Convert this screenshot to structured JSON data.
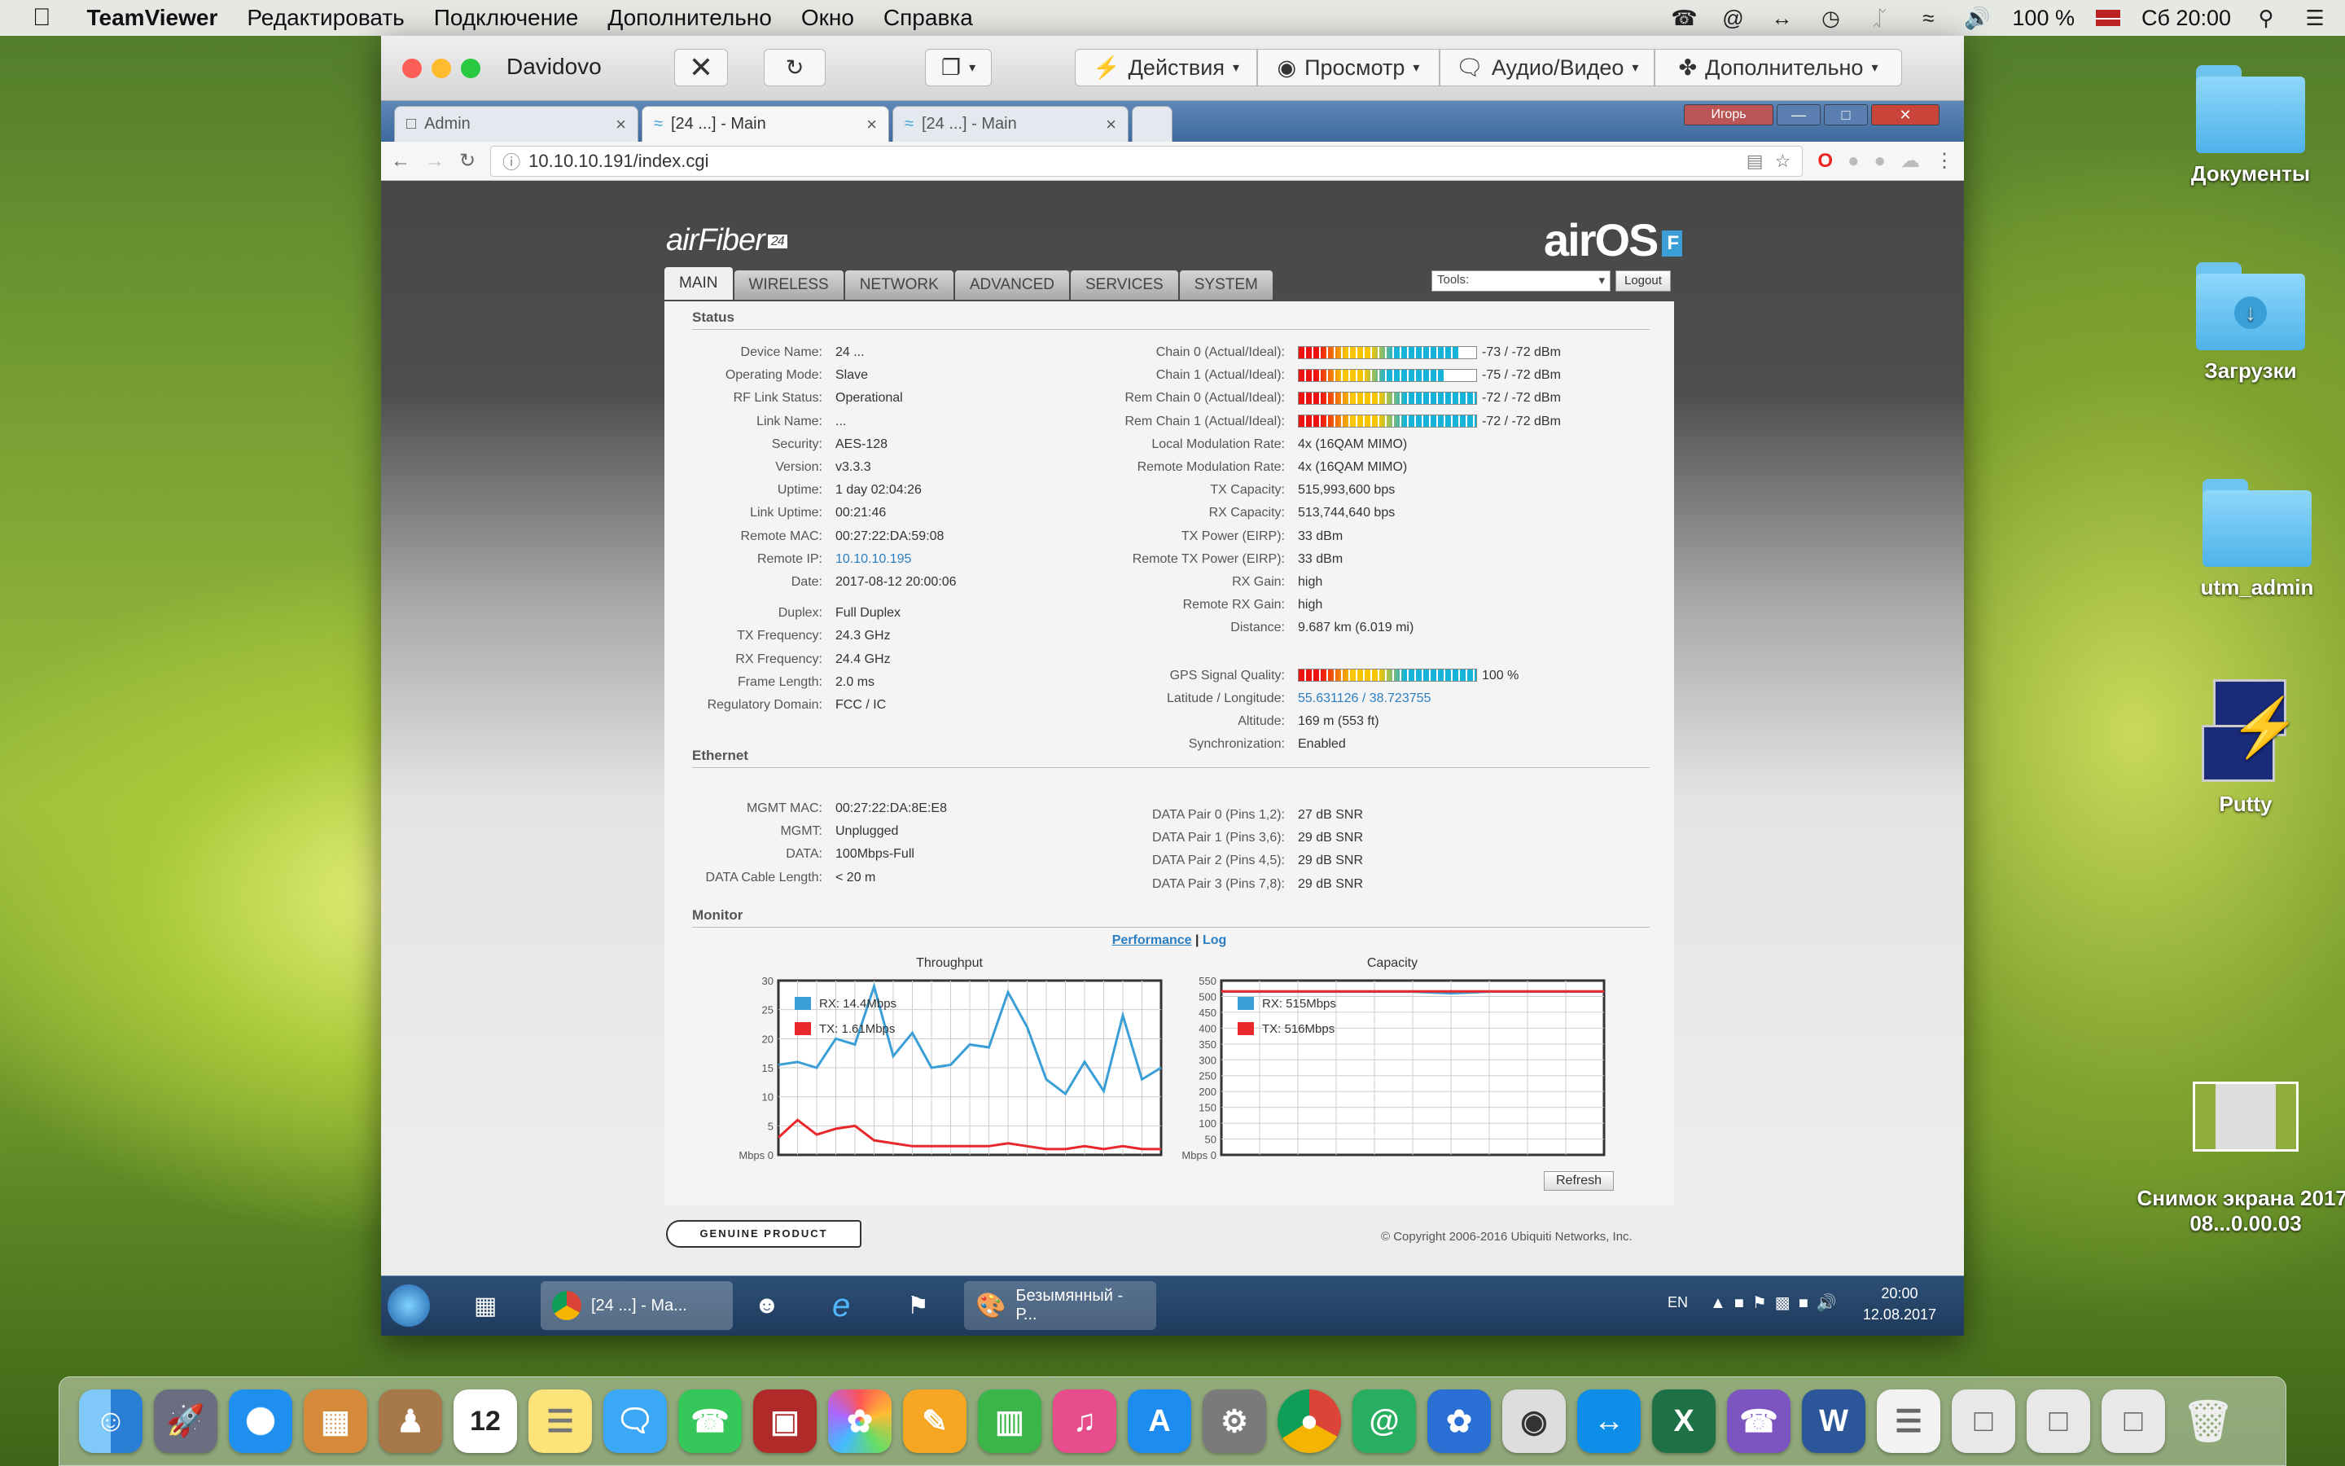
{
  "menubar": {
    "app": "TeamViewer",
    "items": [
      "Редактировать",
      "Подключение",
      "Дополнительно",
      "Окно",
      "Справка"
    ],
    "battery": "100 %",
    "clock": "Сб 20:00"
  },
  "desktop": {
    "icons": [
      {
        "label": "Документы"
      },
      {
        "label": "Загрузки"
      },
      {
        "label": "utm_admin"
      },
      {
        "label": "Putty"
      },
      {
        "label": "Снимок экрана 2017-08...0.00.03"
      }
    ]
  },
  "teamviewer": {
    "title": "Davidovo",
    "actions": "Действия",
    "view": "Просмотр",
    "audio": "Аудио/Видео",
    "extra": "Дополнительно"
  },
  "browser": {
    "tabs": [
      {
        "label": "Admin"
      },
      {
        "label": "[24 ...] - Main"
      },
      {
        "label": "[24 ...] - Main"
      }
    ],
    "user_badge": "Игорь",
    "url": "10.10.10.191/index.cgi"
  },
  "airos": {
    "logo_left": "airFiber",
    "logo_left_badge": "24",
    "logo_right": "airOS",
    "logo_right_badge": "F",
    "tabs": [
      "MAIN",
      "WIRELESS",
      "NETWORK",
      "ADVANCED",
      "SERVICES",
      "SYSTEM"
    ],
    "tools_label": "Tools:",
    "logout": "Logout",
    "status_title": "Status",
    "status_left": [
      {
        "label": "Device Name:",
        "value": "24 ..."
      },
      {
        "label": "Operating Mode:",
        "value": "Slave"
      },
      {
        "label": "RF Link Status:",
        "value": "Operational"
      },
      {
        "label": "Link Name:",
        "value": "..."
      },
      {
        "label": "Security:",
        "value": "AES-128"
      },
      {
        "label": "Version:",
        "value": "v3.3.3"
      },
      {
        "label": "Uptime:",
        "value": "1 day 02:04:26"
      },
      {
        "label": "Link Uptime:",
        "value": "00:21:46"
      },
      {
        "label": "Remote MAC:",
        "value": "00:27:22:DA:59:08"
      },
      {
        "label": "Remote IP:",
        "value": "10.10.10.195"
      },
      {
        "label": "Date:",
        "value": "2017-08-12 20:00:06"
      },
      {
        "label": "Duplex:",
        "value": "Full Duplex"
      },
      {
        "label": "TX Frequency:",
        "value": "24.3 GHz"
      },
      {
        "label": "RX Frequency:",
        "value": "24.4 GHz"
      },
      {
        "label": "Frame Length:",
        "value": "2.0 ms"
      },
      {
        "label": "Regulatory Domain:",
        "value": "FCC / IC"
      }
    ],
    "status_right": [
      {
        "label": "Chain 0 (Actual/Ideal):",
        "value": "-73 / -72 dBm",
        "bar": 0.9
      },
      {
        "label": "Chain 1 (Actual/Ideal):",
        "value": "-75 / -72 dBm",
        "bar": 0.82
      },
      {
        "label": "Rem Chain 0 (Actual/Ideal):",
        "value": "-72 / -72 dBm",
        "bar": 1.0
      },
      {
        "label": "Rem Chain 1 (Actual/Ideal):",
        "value": "-72 / -72 dBm",
        "bar": 1.0
      },
      {
        "label": "Local Modulation Rate:",
        "value": "4x (16QAM MIMO)"
      },
      {
        "label": "Remote Modulation Rate:",
        "value": "4x (16QAM MIMO)"
      },
      {
        "label": "TX Capacity:",
        "value": "515,993,600 bps"
      },
      {
        "label": "RX Capacity:",
        "value": "513,744,640 bps"
      },
      {
        "label": "TX Power (EIRP):",
        "value": "33 dBm"
      },
      {
        "label": "Remote TX Power (EIRP):",
        "value": "33 dBm"
      },
      {
        "label": "RX Gain:",
        "value": "high"
      },
      {
        "label": "Remote RX Gain:",
        "value": "high"
      },
      {
        "label": "Distance:",
        "value": "9.687 km (6.019 mi)"
      },
      {
        "label": "GPS Signal Quality:",
        "value": "100 %",
        "bar": 1.0
      },
      {
        "label": "Latitude / Longitude:",
        "value": "55.631126 / 38.723755"
      },
      {
        "label": "Altitude:",
        "value": "169 m (553 ft)"
      },
      {
        "label": "Synchronization:",
        "value": "Enabled"
      }
    ],
    "ethernet_title": "Ethernet",
    "eth_left": [
      {
        "label": "MGMT MAC:",
        "value": "00:27:22:DA:8E:E8"
      },
      {
        "label": "MGMT:",
        "value": "Unplugged"
      },
      {
        "label": "DATA:",
        "value": "100Mbps-Full"
      },
      {
        "label": "DATA Cable Length:",
        "value": "< 20 m"
      }
    ],
    "eth_right": [
      {
        "label": "DATA Pair 0 (Pins 1,2):",
        "value": "27 dB SNR"
      },
      {
        "label": "DATA Pair 1 (Pins 3,6):",
        "value": "29 dB SNR"
      },
      {
        "label": "DATA Pair 2 (Pins 4,5):",
        "value": "29 dB SNR"
      },
      {
        "label": "DATA Pair 3 (Pins 7,8):",
        "value": "29 dB SNR"
      }
    ],
    "monitor_title": "Monitor",
    "monitor_links": {
      "performance": "Performance",
      "sep": "|",
      "log": "Log"
    },
    "refresh": "Refresh",
    "genuine": "GENUINE PRODUCT",
    "copyright": "© Copyright 2006-2016 Ubiquiti Networks, Inc."
  },
  "chart_data": [
    {
      "type": "line",
      "title": "Throughput",
      "ylabel": "Mbps",
      "ylim": [
        0,
        30
      ],
      "yticks": [
        0,
        5,
        10,
        15,
        20,
        25,
        30
      ],
      "series": [
        {
          "name": "RX: 14.4Mbps",
          "color": "#3a9fd6",
          "values": [
            15.5,
            16,
            15,
            20,
            19,
            29,
            17,
            21,
            15,
            15.5,
            19,
            18.5,
            28,
            22,
            13,
            10.5,
            16,
            11,
            24,
            13,
            15
          ]
        },
        {
          "name": "TX: 1.61Mbps",
          "color": "#e8282b",
          "values": [
            3,
            6,
            3.5,
            4.5,
            5,
            2.5,
            2,
            1.5,
            1.5,
            1.5,
            1.5,
            1.5,
            2,
            1.5,
            1,
            1,
            1.5,
            1,
            1.5,
            1,
            1
          ]
        }
      ]
    },
    {
      "type": "line",
      "title": "Capacity",
      "ylabel": "Mbps",
      "ylim": [
        0,
        550
      ],
      "yticks": [
        0,
        50,
        100,
        150,
        200,
        250,
        300,
        350,
        400,
        450,
        500,
        550
      ],
      "series": [
        {
          "name": "RX: 515Mbps",
          "color": "#3a9fd6",
          "values": [
            515,
            515,
            515,
            515,
            515,
            515,
            510,
            515,
            515,
            515,
            515
          ]
        },
        {
          "name": "TX: 516Mbps",
          "color": "#e8282b",
          "values": [
            516,
            516,
            516,
            516,
            516,
            516,
            516,
            516,
            516,
            516,
            516
          ]
        }
      ]
    }
  ],
  "wintaskbar": {
    "items": [
      {
        "label": "[24 ...] - Ma..."
      },
      {
        "label": "Безымянный - Р..."
      }
    ],
    "lang": "EN",
    "time": "20:00",
    "date": "12.08.2017"
  }
}
